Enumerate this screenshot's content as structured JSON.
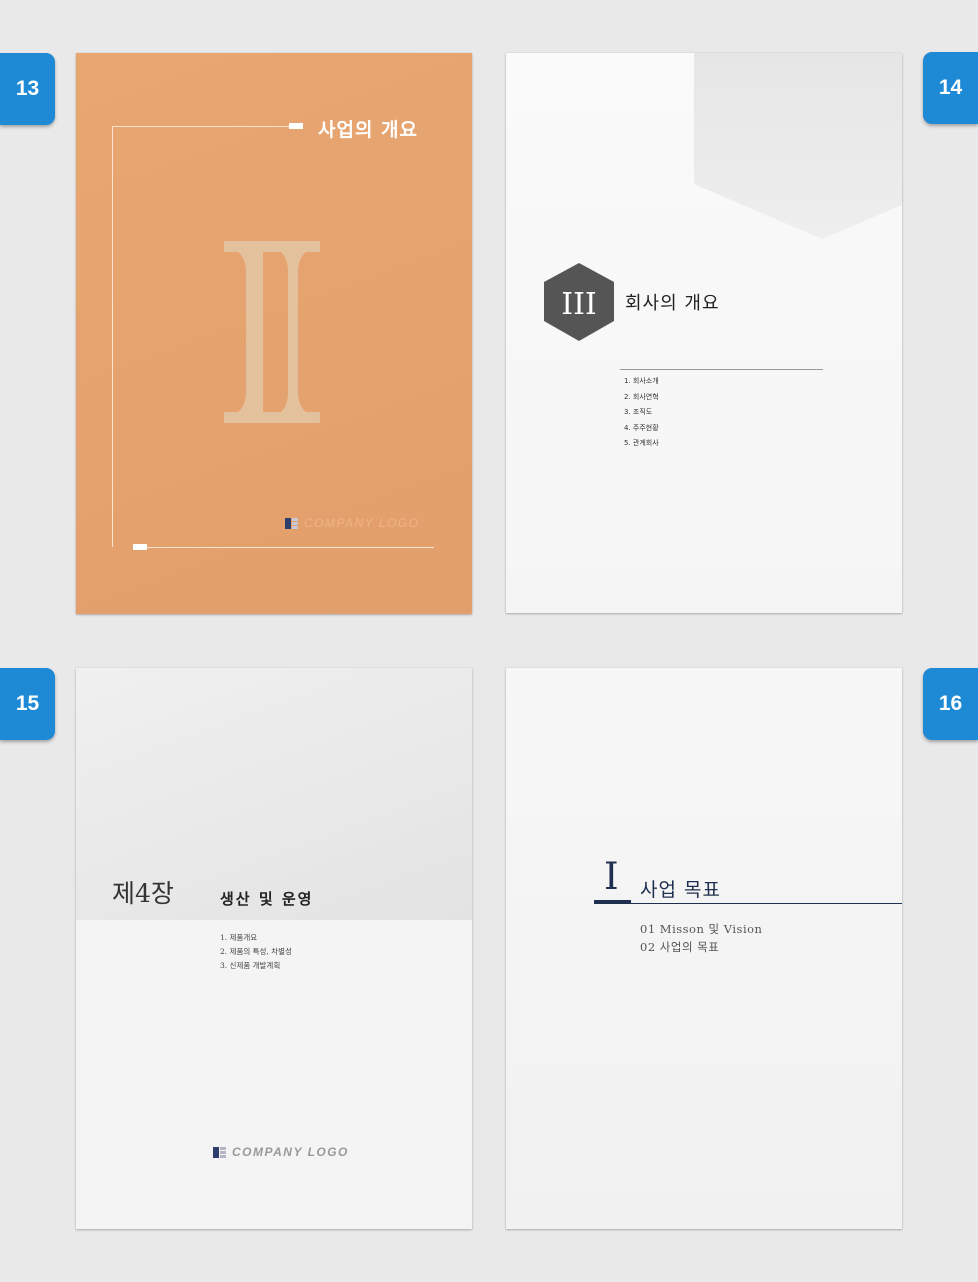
{
  "badges": {
    "p13": "13",
    "p14": "14",
    "p15": "15",
    "p16": "16"
  },
  "page13": {
    "title": "사업의 개요",
    "logo_text": "COMPANY LOGO"
  },
  "page14": {
    "numeral": "III",
    "title": "회사의 개요",
    "toc": [
      "1. 회사소개",
      "2. 회사연혁",
      "3. 조직도",
      "4. 주주현황",
      "5. 관계회사"
    ]
  },
  "page15": {
    "chapter": "제4장",
    "subtitle": "생산 및 운영",
    "toc": [
      "1. 제품개요",
      "2. 제품의 특성, 차별성",
      "3. 신제품 개발계획"
    ],
    "logo_text": "COMPANY LOGO"
  },
  "page16": {
    "numeral": "I",
    "title": "사업 목표",
    "toc": [
      "01 Misson 및 Vision",
      "02 사업의 목표"
    ]
  },
  "colors": {
    "badge": "#1e8ad6",
    "orange_page": "#e5a36e",
    "navy": "#1f2f4f",
    "hexagon": "#555555"
  }
}
